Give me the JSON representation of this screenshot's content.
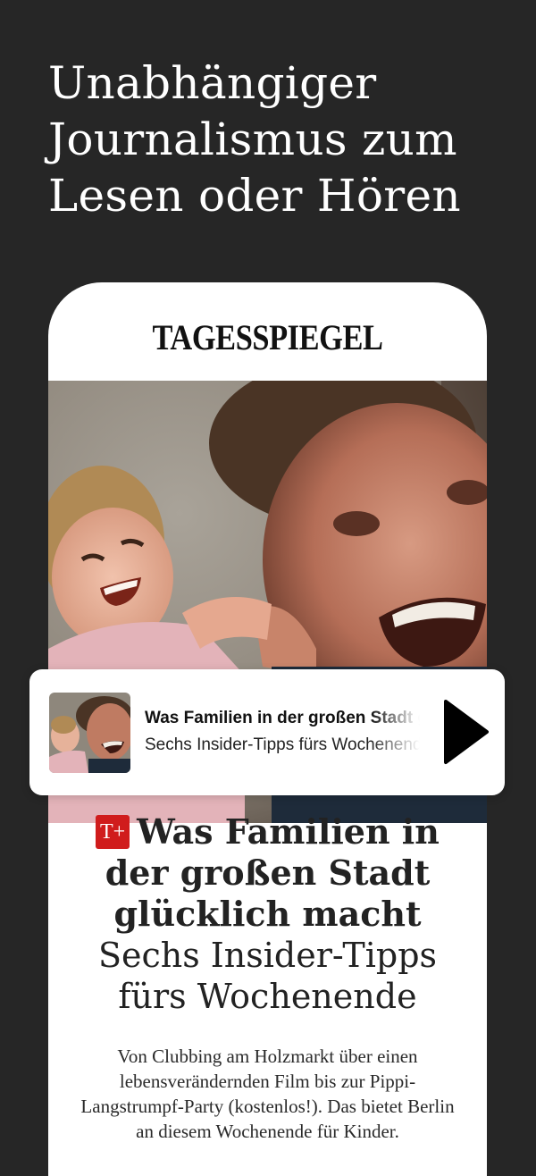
{
  "promo": {
    "headline": "Unabhängiger Journalismus zum Lesen oder Hören"
  },
  "app": {
    "logo_text": "TAGESSPIEGEL"
  },
  "article": {
    "badge_text": "T+",
    "title_bold": "Was Familien in der großen Stadt glücklich macht",
    "title_regular": "Sechs Insider-Tipps fürs Wochenende",
    "teaser": "Von Clubbing am Holzmarkt über einen lebensverändernden Film bis zur Pippi-Langstrumpf-Party (kostenlos!). Das bietet Berlin an diesem Wochenende für Kinder."
  },
  "player": {
    "title": "Was Familien in der großen Stadt glücklich macht",
    "subtitle": "Sechs Insider-Tipps fürs Wochenende",
    "icon": "play-icon"
  },
  "colors": {
    "background": "#262626",
    "card": "#ffffff",
    "badge": "#d01c1c"
  }
}
